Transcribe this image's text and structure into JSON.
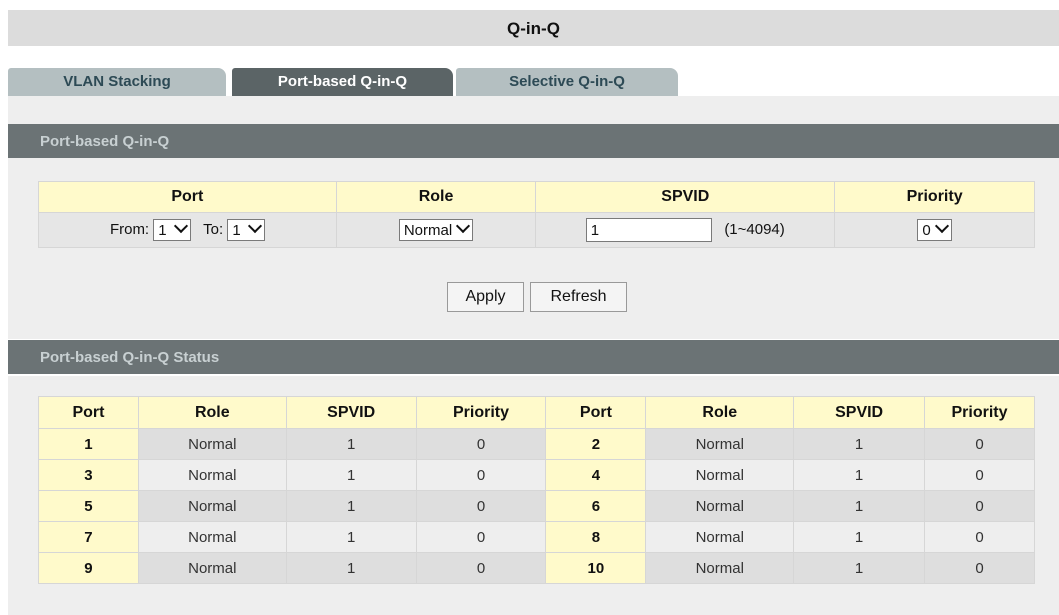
{
  "page": {
    "title": "Q-in-Q"
  },
  "tabs": [
    {
      "label": "VLAN Stacking",
      "active": false
    },
    {
      "label": "Port-based Q-in-Q",
      "active": true
    },
    {
      "label": "Selective Q-in-Q",
      "active": false
    }
  ],
  "config": {
    "section_title": "Port-based Q-in-Q",
    "headers": {
      "port": "Port",
      "role": "Role",
      "spvid": "SPVID",
      "priority": "Priority"
    },
    "from_label": "From:",
    "from_value": "1",
    "to_label": "To:",
    "to_value": "1",
    "role_value": "Normal",
    "spvid_value": "1",
    "spvid_range": "(1~4094)",
    "priority_value": "0",
    "apply_label": "Apply",
    "refresh_label": "Refresh"
  },
  "status": {
    "section_title": "Port-based Q-in-Q Status",
    "headers": [
      "Port",
      "Role",
      "SPVID",
      "Priority",
      "Port",
      "Role",
      "SPVID",
      "Priority"
    ],
    "rows": [
      [
        "1",
        "Normal",
        "1",
        "0",
        "2",
        "Normal",
        "1",
        "0"
      ],
      [
        "3",
        "Normal",
        "1",
        "0",
        "4",
        "Normal",
        "1",
        "0"
      ],
      [
        "5",
        "Normal",
        "1",
        "0",
        "6",
        "Normal",
        "1",
        "0"
      ],
      [
        "7",
        "Normal",
        "1",
        "0",
        "8",
        "Normal",
        "1",
        "0"
      ],
      [
        "9",
        "Normal",
        "1",
        "0",
        "10",
        "Normal",
        "1",
        "0"
      ]
    ]
  },
  "colors": {
    "header_yellow": "#fffacb",
    "section_header": "#6b7375",
    "active_tab": "#5b6466",
    "inactive_tab": "#b4bfc1"
  }
}
